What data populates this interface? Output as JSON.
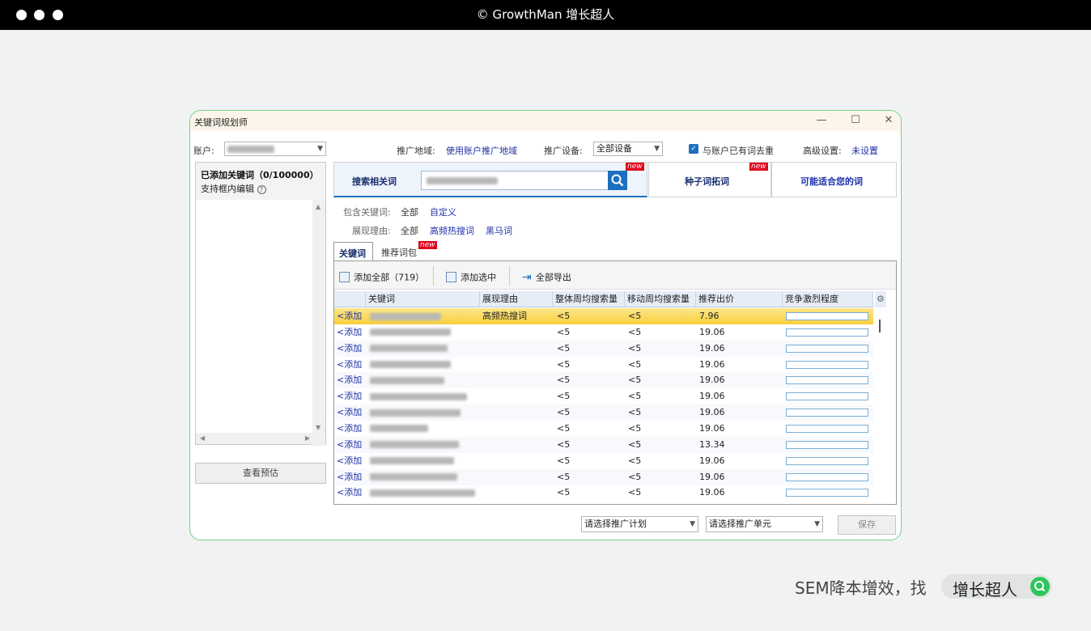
{
  "topbar": {
    "title": "© GrowthMan 增长超人"
  },
  "window": {
    "title": "关键词规划师",
    "min": "—",
    "max": "☐",
    "close": "✕"
  },
  "account": {
    "label": "账户:"
  },
  "region": {
    "label": "推广地域:",
    "value": "使用账户推广地域"
  },
  "device": {
    "label": "推广设备:",
    "value": "全部设备"
  },
  "dedupe": {
    "label": "与账户已有词去重",
    "checked": true
  },
  "advanced": {
    "label": "高级设置:",
    "value": "未设置"
  },
  "left": {
    "title": "已添加关键词（0/100000）",
    "subtitle": "支持框内编辑",
    "help": "?",
    "preview_button": "查看预估"
  },
  "tabs": {
    "search": "搜索相关词",
    "seed": "种子词拓词",
    "suggest": "可能适合您的词",
    "new": "new"
  },
  "filters": {
    "include_label": "包含关键词:",
    "include_all": "全部",
    "include_custom": "自定义",
    "reason_label": "展现理由:",
    "reason_all": "全部",
    "reason_hot": "高频热搜词",
    "reason_dark": "黑马词"
  },
  "subtabs": {
    "keywords": "关键词",
    "packages": "推荐词包",
    "new": "new"
  },
  "toolbar": {
    "add_all": "添加全部（719）",
    "add_selected": "添加选中",
    "export_all": "全部导出"
  },
  "grid": {
    "columns": [
      "关键词",
      "展现理由",
      "整体周均搜索量",
      "移动周均搜索量",
      "推荐出价",
      "竞争激烈程度"
    ],
    "add_label": "<添加",
    "rows": [
      {
        "reason": "高频热搜词",
        "overall": "<5",
        "mobile": "<5",
        "bid": "7.96",
        "selected": true
      },
      {
        "reason": "",
        "overall": "<5",
        "mobile": "<5",
        "bid": "19.06"
      },
      {
        "reason": "",
        "overall": "<5",
        "mobile": "<5",
        "bid": "19.06"
      },
      {
        "reason": "",
        "overall": "<5",
        "mobile": "<5",
        "bid": "19.06"
      },
      {
        "reason": "",
        "overall": "<5",
        "mobile": "<5",
        "bid": "19.06"
      },
      {
        "reason": "",
        "overall": "<5",
        "mobile": "<5",
        "bid": "19.06"
      },
      {
        "reason": "",
        "overall": "<5",
        "mobile": "<5",
        "bid": "19.06"
      },
      {
        "reason": "",
        "overall": "<5",
        "mobile": "<5",
        "bid": "19.06"
      },
      {
        "reason": "",
        "overall": "<5",
        "mobile": "<5",
        "bid": "13.34"
      },
      {
        "reason": "",
        "overall": "<5",
        "mobile": "<5",
        "bid": "19.06"
      },
      {
        "reason": "",
        "overall": "<5",
        "mobile": "<5",
        "bid": "19.06"
      },
      {
        "reason": "",
        "overall": "<5",
        "mobile": "<5",
        "bid": "19.06"
      }
    ]
  },
  "footer": {
    "plan_placeholder": "请选择推广计划",
    "unit_placeholder": "请选择推广单元",
    "save": "保存"
  },
  "promo": {
    "text": "SEM降本增效，找",
    "brand": "增长超人"
  },
  "colors": {
    "accent": "#1d6fbf",
    "selected_row": "#fbd95a",
    "frame": "#72d38b"
  }
}
